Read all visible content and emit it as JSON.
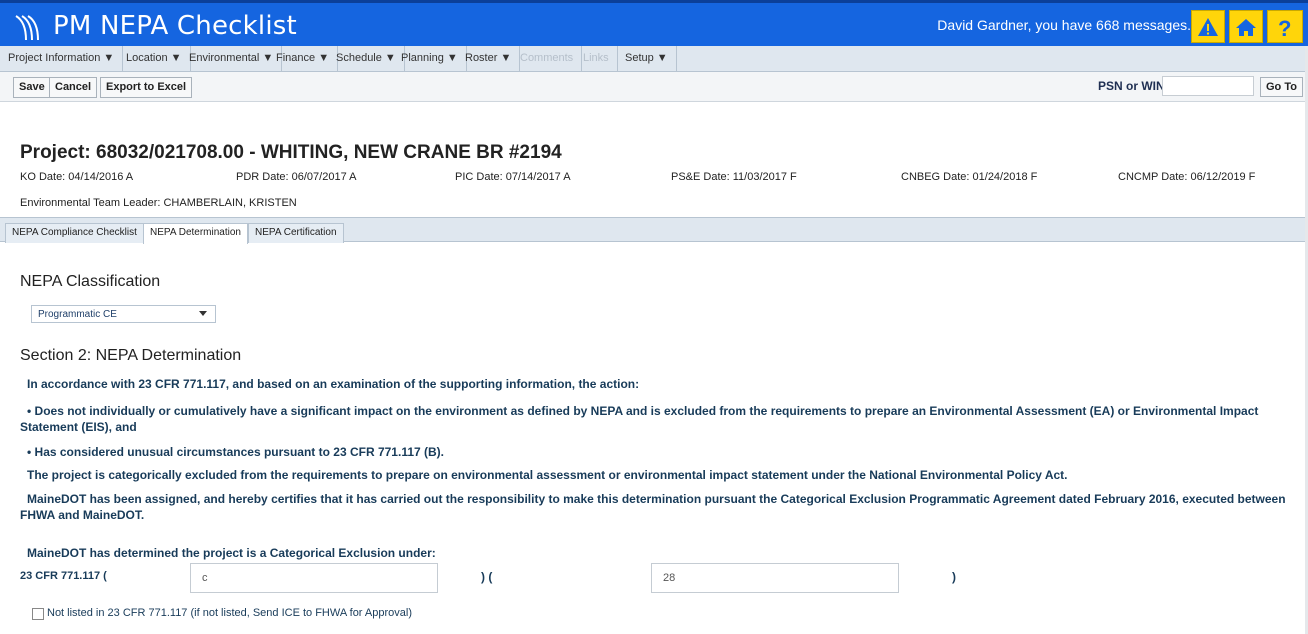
{
  "app": {
    "title": "PM NEPA Checklist",
    "message": "David Gardner, you have 668 messages.",
    "icons": {
      "logo": "signal-logo-icon",
      "alert": "warning-icon",
      "home": "home-icon",
      "help": "help-icon"
    },
    "colors": {
      "header_blue": "#1565e0",
      "icon_yellow": "#ffd50a",
      "statement_text": "#183b59"
    }
  },
  "menu": {
    "items": [
      {
        "label": "Project Information ▼"
      },
      {
        "label": "Location ▼"
      },
      {
        "label": "Environmental ▼"
      },
      {
        "label": "Finance ▼"
      },
      {
        "label": "Schedule ▼"
      },
      {
        "label": "Planning ▼"
      },
      {
        "label": "Roster ▼"
      },
      {
        "label": "Comments"
      },
      {
        "label": "Links"
      },
      {
        "label": "Setup ▼"
      }
    ]
  },
  "actions": {
    "save": "Save",
    "cancel": "Cancel",
    "export": "Export to Excel",
    "psn_label": "PSN or WIN",
    "psn_value": "",
    "goto": "Go To"
  },
  "project": {
    "title": "Project: 68032/021708.00 - WHITING, NEW CRANE BR #2194",
    "dates": [
      {
        "text": "KO Date: 04/14/2016 A"
      },
      {
        "text": "PDR Date: 06/07/2017 A"
      },
      {
        "text": "PIC Date: 07/14/2017 A"
      },
      {
        "text": "PS&E Date: 11/03/2017 F"
      },
      {
        "text": "CNBEG Date: 01/24/2018 F"
      },
      {
        "text": "CNCMP Date: 06/12/2019 F"
      }
    ],
    "env_leader": "Environmental Team Leader: CHAMBERLAIN, KRISTEN"
  },
  "tabs": [
    {
      "label": "NEPA Compliance Checklist"
    },
    {
      "label": "NEPA Determination"
    },
    {
      "label": "NEPA Certification"
    }
  ],
  "classification": {
    "heading": "NEPA Classification",
    "selected": "Programmatic CE"
  },
  "determination": {
    "heading": "Section 2: NEPA Determination",
    "intro": "In accordance with 23 CFR 771.117, and based on an examination of the supporting information, the action:",
    "bullet1": "• Does not individually or cumulatively have a significant impact on the environment as defined by NEPA and is excluded from the requirements to prepare an Environmental Assessment (EA) or Environmental Impact Statement (EIS), and",
    "bullet2": "• Has considered unusual circumstances pursuant to 23 CFR 771.117 (B).",
    "excluded": "The project is categorically excluded from the requirements to prepare on environmental assessment or environmental impact statement under the National Environmental Policy Act.",
    "assigned": "MaineDOT has been assigned, and hereby certifies that it has carried out the responsibility to make this determination pursuant the Categorical Exclusion Programmatic Agreement dated February 2016, executed between FHWA and MaineDOT.",
    "determined": "MaineDOT has determined the project is a Categorical Exclusion under:",
    "cfr_label": "23 CFR 771.117 (",
    "paren_mid": ") (",
    "paren_end": ")",
    "field1": "c",
    "field2": "28",
    "not_listed": "Not listed in 23 CFR 771.117 (if not listed, Send ICE to FHWA for Approval)",
    "not_listed_checked": false
  }
}
